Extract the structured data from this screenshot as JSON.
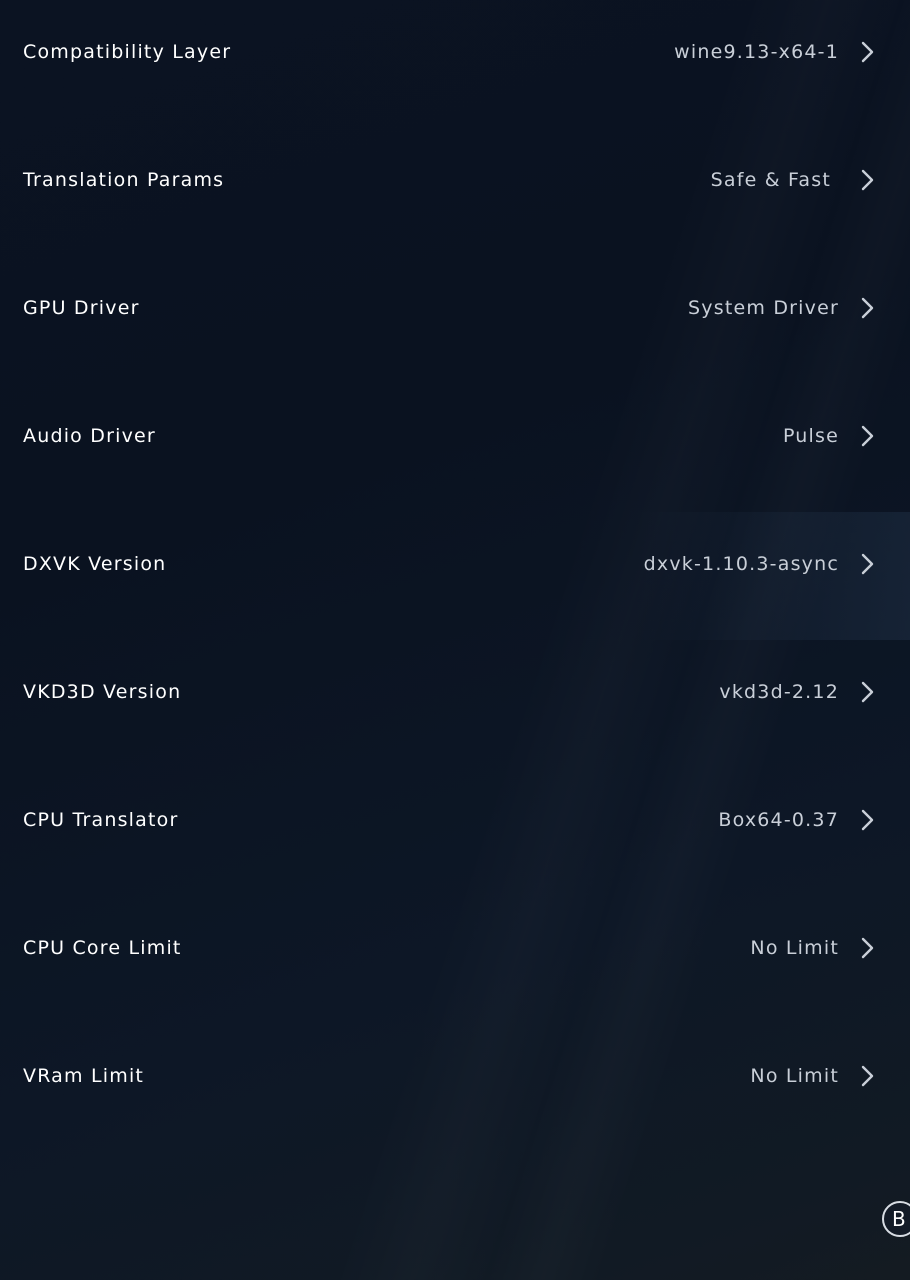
{
  "settings": [
    {
      "label": "Compatibility Layer",
      "value": "wine9.13-x64-1"
    },
    {
      "label": "Translation Params",
      "value": "Safe & Fast"
    },
    {
      "label": "GPU Driver",
      "value": "System Driver"
    },
    {
      "label": "Audio Driver",
      "value": "Pulse"
    },
    {
      "label": "DXVK Version",
      "value": "dxvk-1.10.3-async"
    },
    {
      "label": "VKD3D Version",
      "value": "vkd3d-2.12"
    },
    {
      "label": "CPU Translator",
      "value": "Box64-0.37"
    },
    {
      "label": "CPU Core Limit",
      "value": "No Limit"
    },
    {
      "label": "VRam Limit",
      "value": "No Limit"
    }
  ],
  "icons": {
    "row_arrow": "chevron-right-icon"
  },
  "colors": {
    "background": "#0b1322",
    "label": "#ffffff",
    "value": "#c9cfd8",
    "chevron": "#c9cfd8"
  },
  "controller": {
    "back_label": "B"
  }
}
